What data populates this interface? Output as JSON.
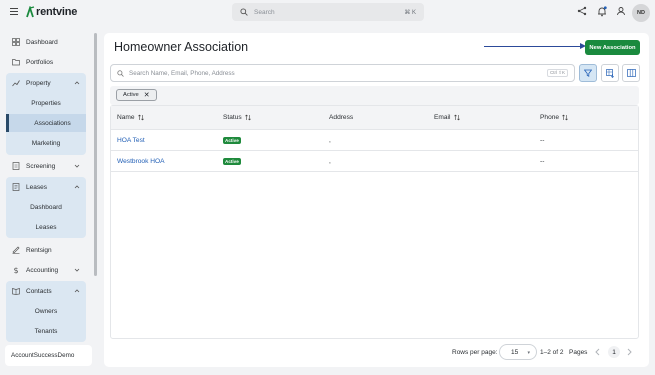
{
  "app": {
    "brand": "rentvine"
  },
  "search": {
    "placeholder": "Search",
    "shortcut": "⌘ K"
  },
  "user": {
    "initials": "ND"
  },
  "sidebar": {
    "items": {
      "dashboard": "Dashboard",
      "portfolios": "Portfolios",
      "property": "Property",
      "properties": "Properties",
      "associations": "Associations",
      "marketing": "Marketing",
      "screening": "Screening",
      "leases": "Leases",
      "leases_dashboard": "Dashboard",
      "leases_leases": "Leases",
      "rentsign": "Rentsign",
      "accounting": "Accounting",
      "contacts": "Contacts",
      "owners": "Owners",
      "tenants": "Tenants"
    },
    "account": "AccountSuccessDemo"
  },
  "page": {
    "title": "Homeowner Association",
    "new_button": "New Association",
    "search_placeholder": "Search Name, Email, Phone, Address",
    "search_shortcut": "Ctrl ⇧K",
    "filter_chip": "Active"
  },
  "table": {
    "headers": {
      "name": "Name",
      "status": "Status",
      "address": "Address",
      "email": "Email",
      "phone": "Phone"
    },
    "rows": [
      {
        "name": "HOA Test",
        "status": "Active",
        "address": ",",
        "email": "",
        "phone": "--"
      },
      {
        "name": "Westbrook HOA",
        "status": "Active",
        "address": ",",
        "email": "",
        "phone": "--"
      }
    ]
  },
  "pagination": {
    "rows_per_page_label": "Rows per page:",
    "rows_per_page": "15",
    "range": "1–2 of 2",
    "pages_label": "Pages",
    "current_page": "1"
  },
  "colors": {
    "primary_green": "#1a8a3e",
    "link_blue": "#2360b6",
    "nav_group_bg": "#dbe7f2"
  }
}
